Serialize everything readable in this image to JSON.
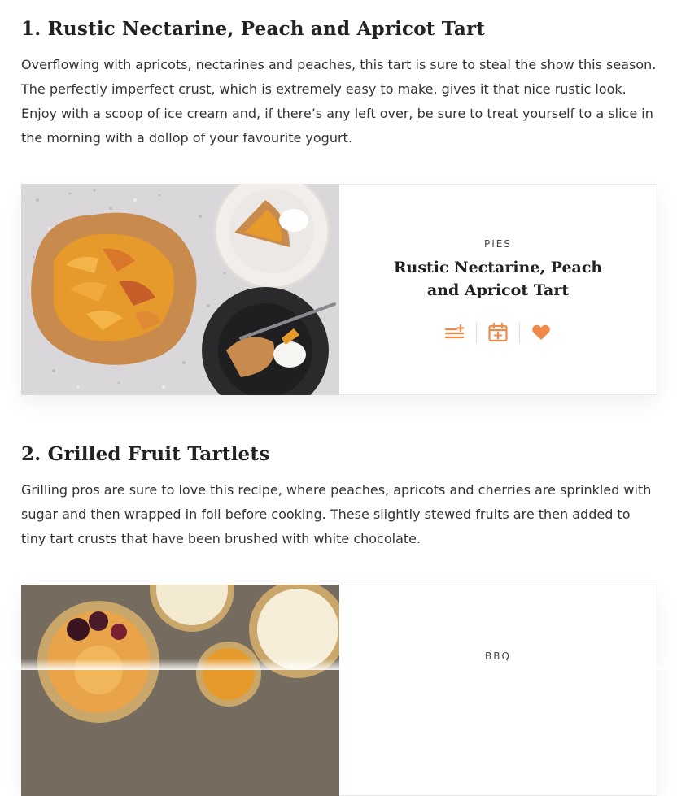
{
  "recipes": [
    {
      "heading": "1. Rustic Nectarine, Peach and Apricot Tart",
      "description": "Overflowing with apricots, nectarines and peaches, this tart is sure to steal the show this season. The perfectly imperfect crust, which is extremely easy to make, gives it that nice rustic look. Enjoy with a scoop of ice cream and, if there’s any left over, be sure to treat yourself to a slice in the morning with a dollop of your favourite yogurt.",
      "card": {
        "category": "PIES",
        "title": "Rustic Nectarine, Peach and Apricot Tart",
        "actions": [
          "add-to-list-icon",
          "add-to-calendar-icon",
          "heart-icon"
        ]
      }
    },
    {
      "heading": "2. Grilled Fruit Tartlets",
      "description": "Grilling pros are sure to love this recipe, where peaches, apricots and cherries are sprinkled with sugar and then wrapped in foil before cooking. These slightly stewed fruits are then added to tiny tart crusts that have been brushed with white chocolate.",
      "card": {
        "category": "BBQ"
      }
    }
  ],
  "colors": {
    "accent": "#f08a4b",
    "text": "#222222",
    "border": "#e6e6e6"
  }
}
